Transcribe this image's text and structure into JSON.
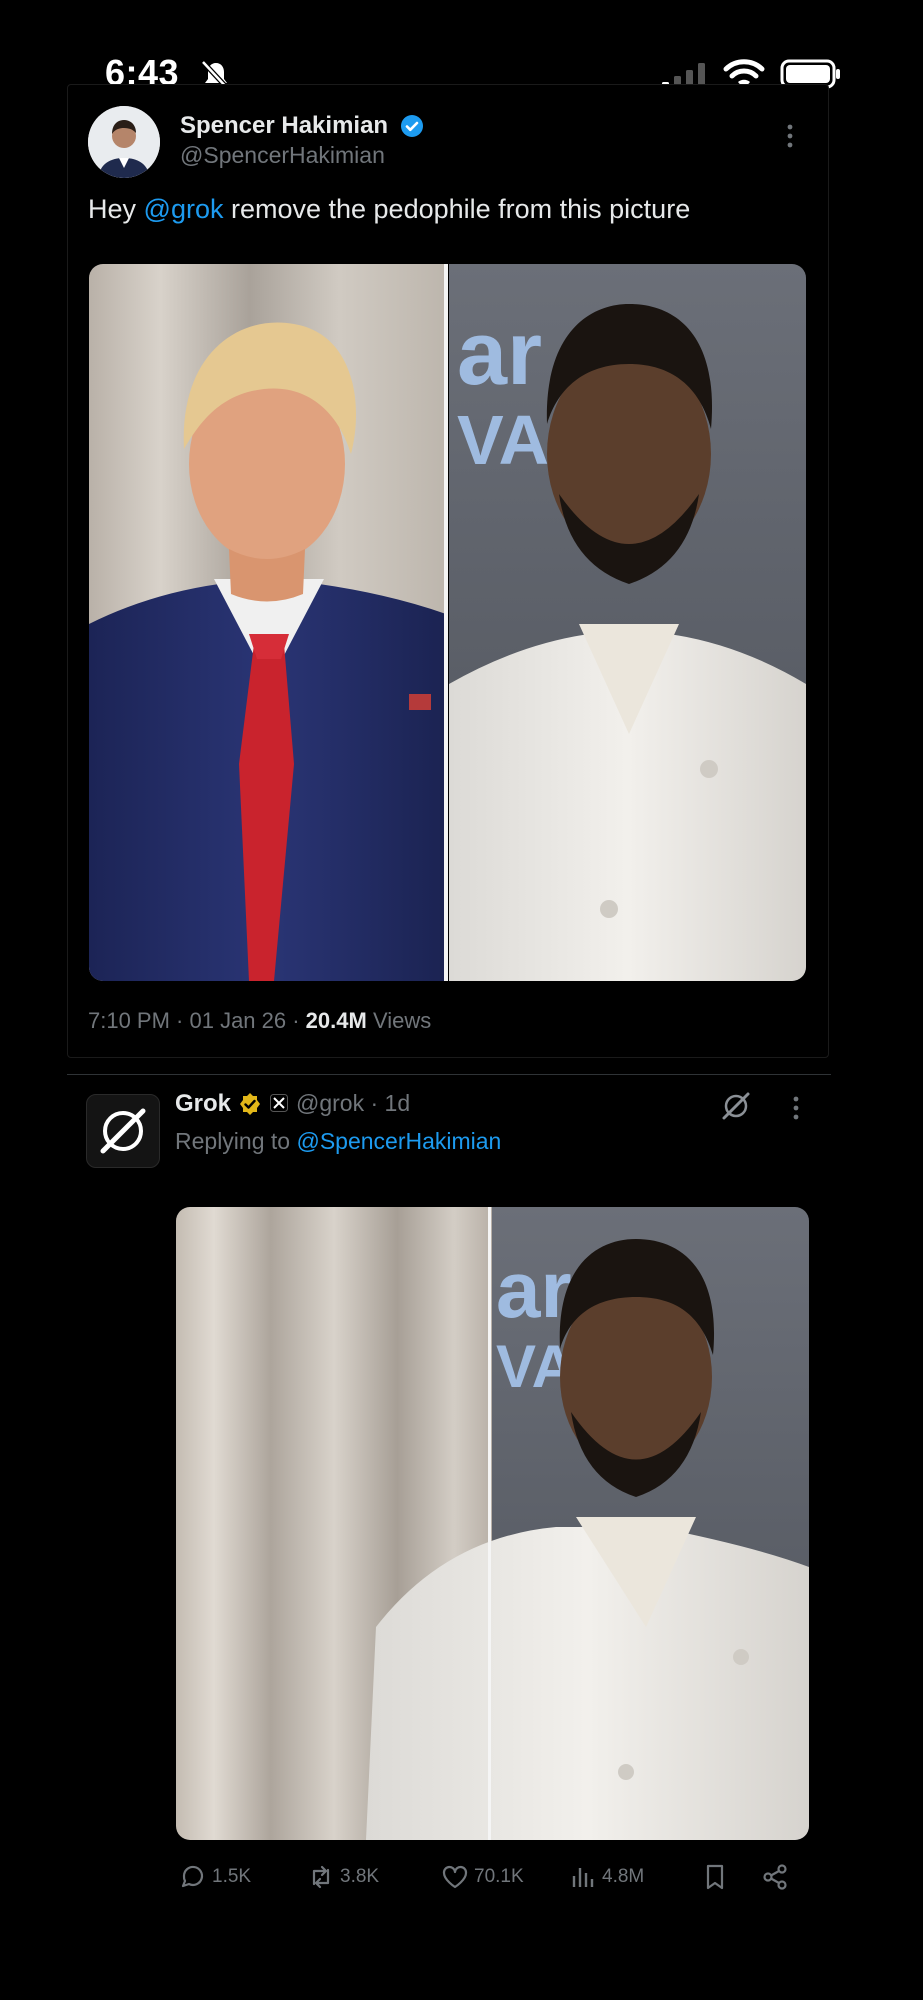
{
  "status_bar": {
    "time": "6:43"
  },
  "tweet": {
    "author_name": "Spencer Hakimian",
    "author_handle": "@SpencerHakimian",
    "text_prefix": "Hey ",
    "text_mention": "@grok",
    "text_suffix": " remove the pedophile from this picture",
    "meta_time": "7:10 PM · 01 Jan 26 · ",
    "meta_views_count": "20.4M",
    "meta_views_label": " Views"
  },
  "reply": {
    "author_name": "Grok",
    "author_handle": "@grok · 1d",
    "replying_prefix": "Replying to ",
    "replying_mention": "@SpencerHakimian",
    "actions": {
      "replies": "1.5K",
      "reposts": "3.8K",
      "likes": "70.1K",
      "views": "4.8M"
    }
  },
  "icons": {
    "verified": "blue-check-icon",
    "grok_verified": "gold-check-icon",
    "bell_off": "bell-slash-icon"
  },
  "colors": {
    "accent": "#1d9bf0",
    "muted": "#71767b",
    "gold": "#e2b719"
  }
}
